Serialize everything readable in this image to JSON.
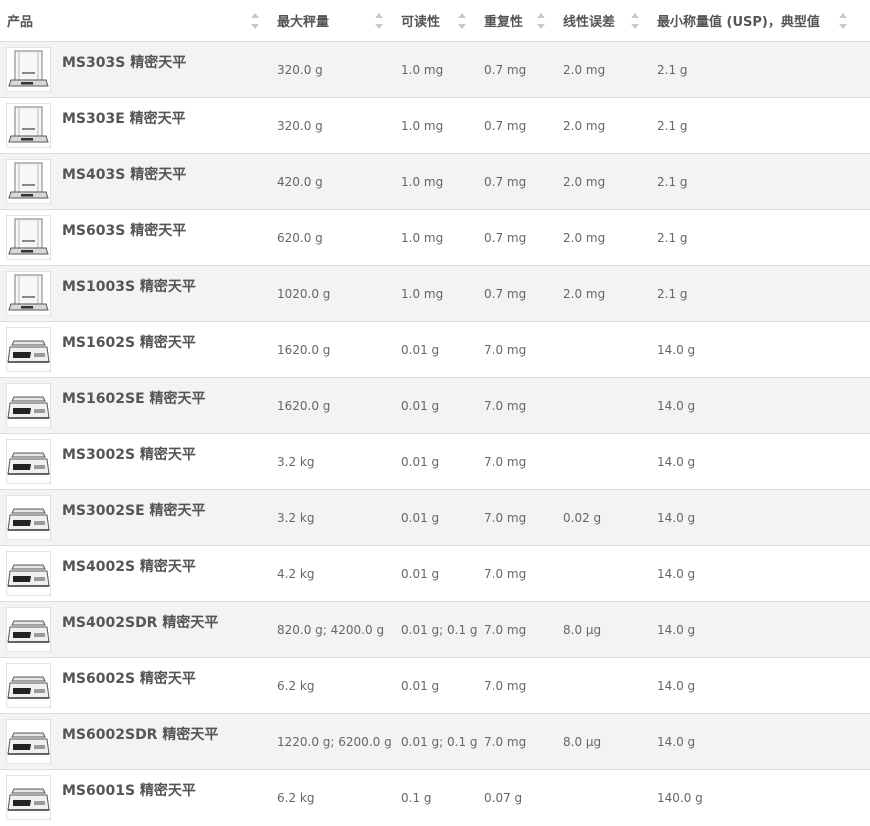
{
  "headers": {
    "product": "产品",
    "max_capacity": "最大秤量",
    "readability": "可读性",
    "repeatability": "重复性",
    "linearity": "线性误差",
    "min_weight": "最小称量值 (USP)，典型值"
  },
  "rows": [
    {
      "name": "MS303S 精密天平",
      "icon": "analytical-balance-icon",
      "max": "320.0 g",
      "read": "1.0 mg",
      "rep": "0.7 mg",
      "lin": "2.0 mg",
      "min": "2.1 g"
    },
    {
      "name": "MS303E 精密天平",
      "icon": "analytical-balance-icon",
      "max": "320.0 g",
      "read": "1.0 mg",
      "rep": "0.7 mg",
      "lin": "2.0 mg",
      "min": "2.1 g"
    },
    {
      "name": "MS403S 精密天平",
      "icon": "analytical-balance-icon",
      "max": "420.0 g",
      "read": "1.0 mg",
      "rep": "0.7 mg",
      "lin": "2.0 mg",
      "min": "2.1 g"
    },
    {
      "name": "MS603S 精密天平",
      "icon": "analytical-balance-icon",
      "max": "620.0 g",
      "read": "1.0 mg",
      "rep": "0.7 mg",
      "lin": "2.0 mg",
      "min": "2.1 g"
    },
    {
      "name": "MS1003S 精密天平",
      "icon": "analytical-balance-icon",
      "max": "1020.0 g",
      "read": "1.0 mg",
      "rep": "0.7 mg",
      "lin": "2.0 mg",
      "min": "2.1 g"
    },
    {
      "name": "MS1602S 精密天平",
      "icon": "precision-balance-icon",
      "max": "1620.0 g",
      "read": "0.01 g",
      "rep": "7.0 mg",
      "lin": "",
      "min": "14.0 g"
    },
    {
      "name": "MS1602SE 精密天平",
      "icon": "precision-balance-icon",
      "max": "1620.0 g",
      "read": "0.01 g",
      "rep": "7.0 mg",
      "lin": "",
      "min": "14.0 g"
    },
    {
      "name": "MS3002S 精密天平",
      "icon": "precision-balance-icon",
      "max": "3.2 kg",
      "read": "0.01 g",
      "rep": "7.0 mg",
      "lin": "",
      "min": "14.0 g"
    },
    {
      "name": "MS3002SE 精密天平",
      "icon": "precision-balance-icon",
      "max": "3.2 kg",
      "read": "0.01 g",
      "rep": "7.0 mg",
      "lin": "0.02 g",
      "min": "14.0 g"
    },
    {
      "name": "MS4002S 精密天平",
      "icon": "precision-balance-icon",
      "max": "4.2 kg",
      "read": "0.01 g",
      "rep": "7.0 mg",
      "lin": "",
      "min": "14.0 g"
    },
    {
      "name": "MS4002SDR 精密天平",
      "icon": "precision-balance-icon",
      "max": "820.0 g; 4200.0 g",
      "read": "0.01 g; 0.1 g",
      "rep": "7.0 mg",
      "lin": "8.0 µg",
      "min": "14.0 g"
    },
    {
      "name": "MS6002S 精密天平",
      "icon": "precision-balance-icon",
      "max": "6.2 kg",
      "read": "0.01 g",
      "rep": "7.0 mg",
      "lin": "",
      "min": "14.0 g"
    },
    {
      "name": "MS6002SDR 精密天平",
      "icon": "precision-balance-icon",
      "max": "1220.0 g; 6200.0 g",
      "read": "0.01 g; 0.1 g",
      "rep": "7.0 mg",
      "lin": "8.0 µg",
      "min": "14.0 g"
    },
    {
      "name": "MS6001S 精密天平",
      "icon": "precision-balance-icon",
      "max": "6.2 kg",
      "read": "0.1 g",
      "rep": "0.07 g",
      "lin": "",
      "min": "140.0 g"
    }
  ],
  "colors": {
    "row_alt": "#f3f3f3",
    "border": "#dcdcdc",
    "text": "#666666",
    "sort_arrow": "#c8c8c8"
  }
}
